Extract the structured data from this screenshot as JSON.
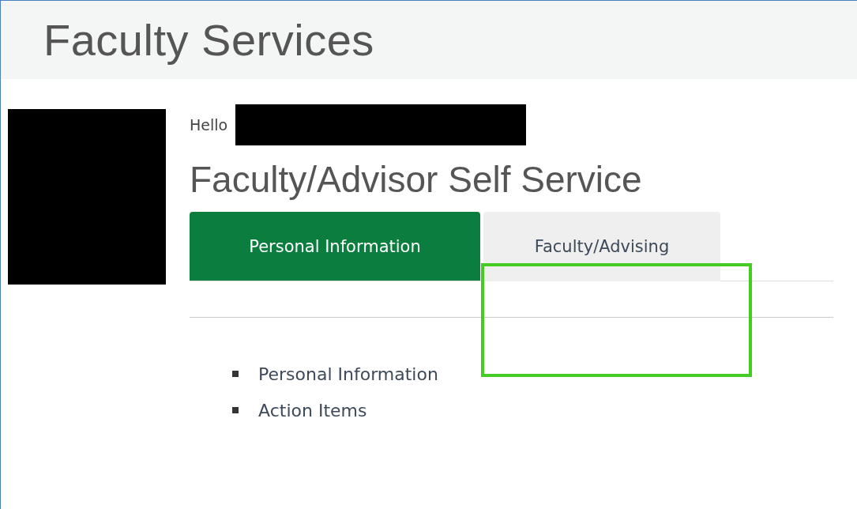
{
  "header": {
    "title": "Faculty Services"
  },
  "greeting": {
    "label": "Hello"
  },
  "page_title": "Faculty/Advisor Self Service",
  "tabs": [
    {
      "label": "Personal Information",
      "selected": true
    },
    {
      "label": "Faculty/Advising",
      "selected": false
    }
  ],
  "links": [
    "Personal Information",
    "Action Items"
  ]
}
